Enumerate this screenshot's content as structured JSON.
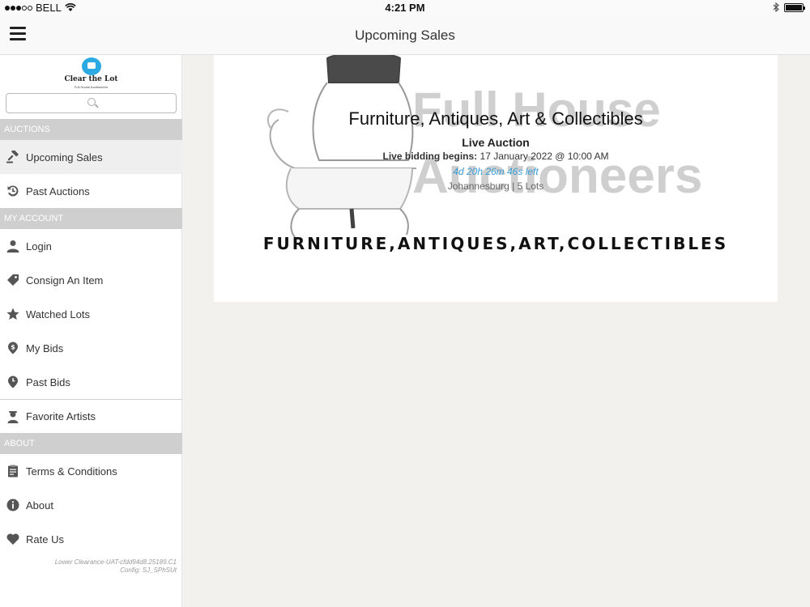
{
  "status_bar": {
    "carrier": "BELL",
    "time": "4:21 PM",
    "battery_level": 1.0
  },
  "nav": {
    "title": "Upcoming Sales"
  },
  "sidebar": {
    "logo_text": "Clear the Lot",
    "logo_sub": "Full House Auctioneers",
    "search_placeholder": "",
    "sections": {
      "auctions": "AUCTIONS",
      "my_account": "MY ACCOUNT",
      "about": "ABOUT"
    },
    "items": {
      "upcoming_sales": "Upcoming Sales",
      "past_auctions": "Past Auctions",
      "login": "Login",
      "consign": "Consign An Item",
      "watched": "Watched Lots",
      "my_bids": "My Bids",
      "past_bids": "Past Bids",
      "favorite_artists": "Favorite Artists",
      "terms": "Terms & Conditions",
      "about": "About",
      "rate_us": "Rate Us"
    },
    "version_line1": "Lower Clearance-UAT-cfdd94d8.25189.C1",
    "version_line2": "Config: SJ_SPhSUt"
  },
  "auction": {
    "title": "Furniture, Antiques, Art & Collectibles",
    "type": "Live Auction",
    "bidding_label": "Live bidding begins:",
    "bidding_date": "17 January 2022 @ 10:00 AM",
    "countdown": "4d 20h 26m 46s left",
    "location": "Johannesburg | 5 Lots",
    "tagline": "FURNITURE,ANTIQUES,ART,COLLECTIBLES",
    "brand_line1": "Full House",
    "brand_line2": "Auctioneers"
  },
  "colors": {
    "accent": "#3a9bd5",
    "section_header": "#cfcfcf",
    "logo_blue": "#2aa9e3"
  }
}
